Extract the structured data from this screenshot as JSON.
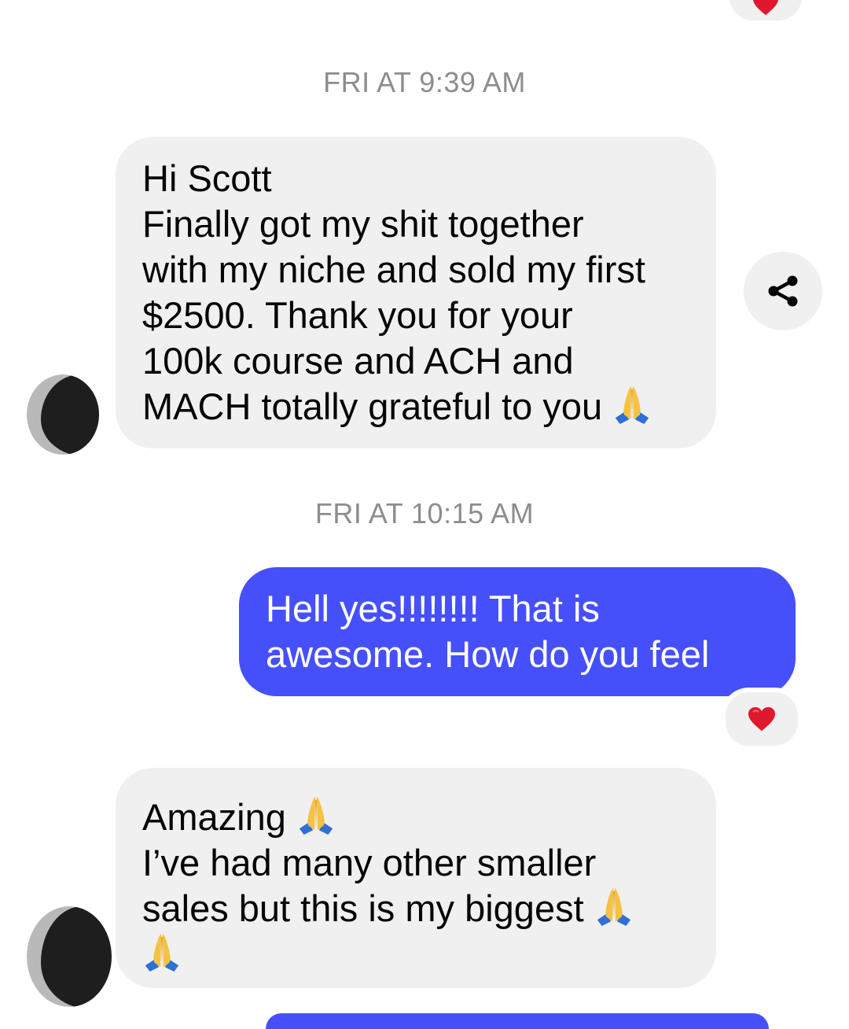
{
  "conversation": {
    "timestamp_1": "FRI AT 9:39 AM",
    "timestamp_2": "FRI AT 10:15 AM",
    "messages": [
      {
        "sender": "contact",
        "lines": [
          "Hi Scott",
          "Finally got my shit together",
          "with my niche and sold my first",
          "$2500. Thank you for your",
          "100k course and ACH and",
          "MACH totally grateful to you"
        ]
      },
      {
        "sender": "me",
        "lines": [
          "Hell yes!!!!!!!! That is",
          "awesome. How do you feel"
        ],
        "reaction": "red-heart"
      },
      {
        "sender": "contact",
        "lines": [
          "Amazing",
          "I’ve had many other smaller",
          "sales but this is my biggest",
          ""
        ]
      }
    ]
  },
  "icons": {
    "share": "share-icon",
    "pray": "folded-hands-emoji",
    "heart": "red-heart-emoji"
  },
  "colors": {
    "incoming_bubble": "#f0f0f0",
    "outgoing_bubble": "#4650fa",
    "timestamp": "#8a8d91",
    "heart": "#e0182d"
  }
}
